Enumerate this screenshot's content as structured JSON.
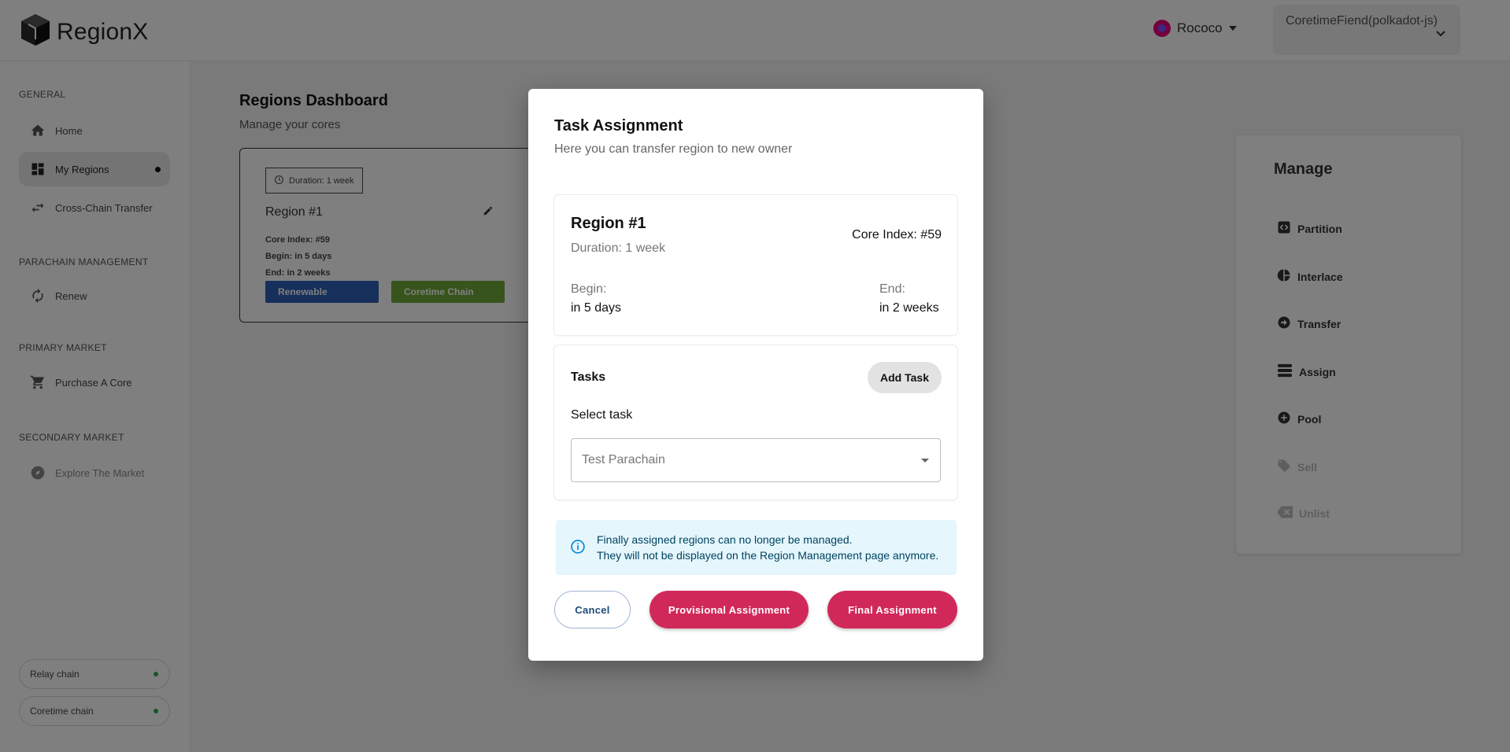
{
  "app": {
    "name": "RegionX"
  },
  "header": {
    "network": {
      "name": "Rococo"
    },
    "account": {
      "label": "CoretimeFiend(polkadot-js)"
    }
  },
  "sidebar": {
    "sections": [
      {
        "title": "GENERAL"
      },
      {
        "title": "PARACHAIN MANAGEMENT"
      },
      {
        "title": "PRIMARY MARKET"
      },
      {
        "title": "SECONDARY MARKET"
      }
    ],
    "items": [
      {
        "label": "Home",
        "icon": "home-icon"
      },
      {
        "label": "My Regions",
        "icon": "dashboard-icon",
        "active": true
      },
      {
        "label": "Cross-Chain Transfer",
        "icon": "swap-icon"
      },
      {
        "label": "Renew",
        "icon": "renew-icon"
      },
      {
        "label": "Purchase A Core",
        "icon": "cart-icon"
      },
      {
        "label": "Explore The Market",
        "icon": "compass-icon",
        "disabled": true
      }
    ],
    "chains": [
      {
        "label": "Relay chain",
        "status_color": "#2fa84f"
      },
      {
        "label": "Coretime chain",
        "status_color": "#2fa84f"
      }
    ]
  },
  "main": {
    "title": "Regions Dashboard",
    "subtitle": "Manage your cores",
    "region_card": {
      "duration": "Duration: 1 week",
      "name": "Region #1",
      "core_index": "Core Index: #59",
      "begin": "Begin: in 5 days",
      "end": "End: in 2 weeks",
      "tags": [
        "Renewable",
        "Coretime Chain"
      ]
    }
  },
  "manage_panel": {
    "title": "Manage",
    "items": [
      {
        "label": "Partition",
        "icon": "code-icon",
        "enabled": true
      },
      {
        "label": "Interlace",
        "icon": "pie-chart-icon",
        "enabled": true
      },
      {
        "label": "Transfer",
        "icon": "arrow-circle-icon",
        "enabled": true
      },
      {
        "label": "Assign",
        "icon": "stack-icon",
        "enabled": true
      },
      {
        "label": "Pool",
        "icon": "plus-circle-icon",
        "enabled": true
      },
      {
        "label": "Sell",
        "icon": "tag-icon",
        "enabled": false
      },
      {
        "label": "Unlist",
        "icon": "backspace-icon",
        "enabled": false
      }
    ]
  },
  "modal": {
    "title": "Task Assignment",
    "subtitle": "Here you can transfer region to new owner",
    "region": {
      "name": "Region #1",
      "duration": "Duration: 1 week",
      "core_index": "Core Index: #59",
      "begin_label": "Begin:",
      "begin_value": "in 5 days",
      "end_label": "End:",
      "end_value": "in 2 weeks"
    },
    "tasks": {
      "title": "Tasks",
      "add_button": "Add Task",
      "select_label": "Select task",
      "selected": "Test Parachain"
    },
    "alert": {
      "line1": "Finally assigned regions can no longer be managed.",
      "line2": "They will not be displayed on the Region Management page anymore."
    },
    "buttons": {
      "cancel": "Cancel",
      "provisional": "Provisional Assignment",
      "final": "Final Assignment"
    }
  }
}
